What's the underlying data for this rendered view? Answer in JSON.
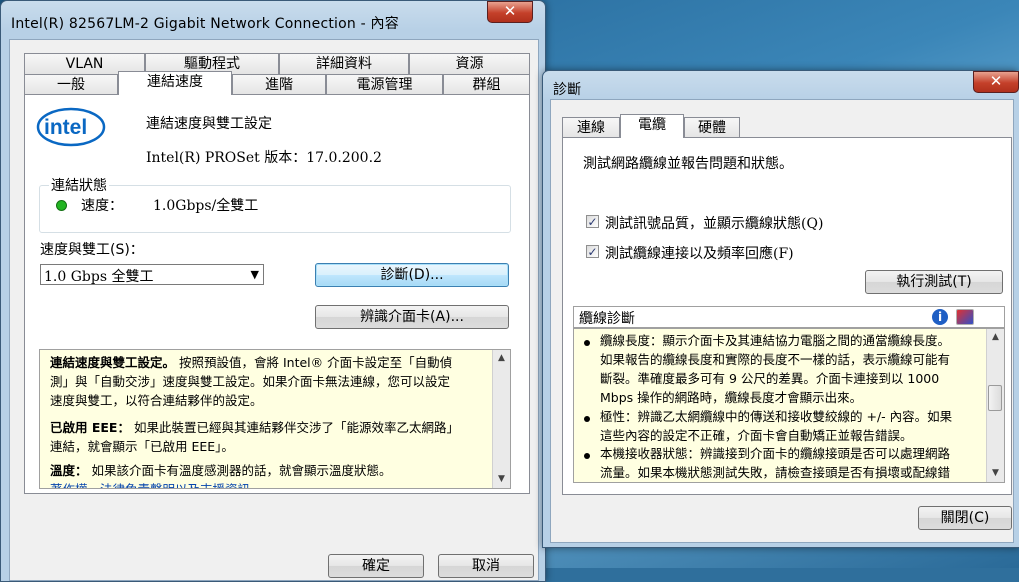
{
  "left_window": {
    "title": "Intel(R) 82567LM-2 Gigabit Network Connection - 內容",
    "close_label": "✕",
    "tabs_row1": [
      "VLAN",
      "驅動程式",
      "詳細資料",
      "資源"
    ],
    "tabs_row2": [
      "一般",
      "連結速度",
      "進階",
      "電源管理",
      "群組"
    ],
    "logo_text": "intel",
    "heading": "連結速度與雙工設定",
    "version": "Intel(R) PROSet 版本：17.0.200.2",
    "status_group": "連結狀態",
    "speed_label": "速度：",
    "speed_value": "1.0Gbps/全雙工",
    "status_color": "#22b422",
    "duplex_label": "速度與雙工(S)：",
    "duplex_value": "1.0 Gbps 全雙工",
    "diagnose_btn": "診斷(D)...",
    "identify_btn": "辨識介面卡(A)...",
    "help": {
      "p1_bold": "連結速度與雙工設定。",
      "p1_rest_l1": "按照預設值，會將 Intel® 介面卡設定至「自動偵",
      "p1_l2": "測」與「自動交涉」速度與雙工設定。如果介面卡無法連線，您可以設定",
      "p1_l3": "速度與雙工，以符合連結夥伴的設定。",
      "p2_bold": "已啟用 EEE：",
      "p2_rest_l1": "如果此裝置已經與其連結夥伴交涉了「能源效率乙太網路」",
      "p2_l2": "連結，就會顯示「已啟用 EEE」。",
      "p3_bold": "溫度：",
      "p3_rest": "如果該介面卡有溫度感測器的話，就會顯示溫度狀態。",
      "link": "著作權、法律免責聲明以及支援資訊"
    },
    "ok_btn": "確定",
    "cancel_btn": "取消"
  },
  "right_window": {
    "title": "診斷",
    "close_label": "✕",
    "tabs": [
      "連線",
      "電纜",
      "硬體"
    ],
    "description": "測試網路纜線並報告問題和狀態。",
    "check1": "測試訊號品質，並顯示纜線狀態(Q)",
    "check2": "測試纜線連接以及頻率回應(F)",
    "run_btn": "執行測試(T)",
    "result_header": "纜線診斷",
    "info_icon": "i",
    "bullets": [
      [
        "纜線長度：顯示介面卡及其連結協力電腦之間的通當纜線長度。",
        "如果報告的纜線長度和實際的長度不一樣的話，表示纜線可能有",
        "斷裂。準確度最多可有 9 公尺的差異。介面卡連接到以 1000",
        "Mbps 操作的網路時，纜線長度才會顯示出來。"
      ],
      [
        "極性：辨識乙太網纜線中的傳送和接收雙絞線的 +/- 內容。如果",
        "這些內容的設定不正確，介面卡會自動矯正並報告錯誤。"
      ],
      [
        "本機接收器狀態：辨識接到介面卡的纜線接頭是否可以處理網路",
        "流量。如果本機狀態測試失敗，請檢查接頭是否有損壞或配線錯"
      ]
    ],
    "close_btn": "關閉(C)"
  }
}
